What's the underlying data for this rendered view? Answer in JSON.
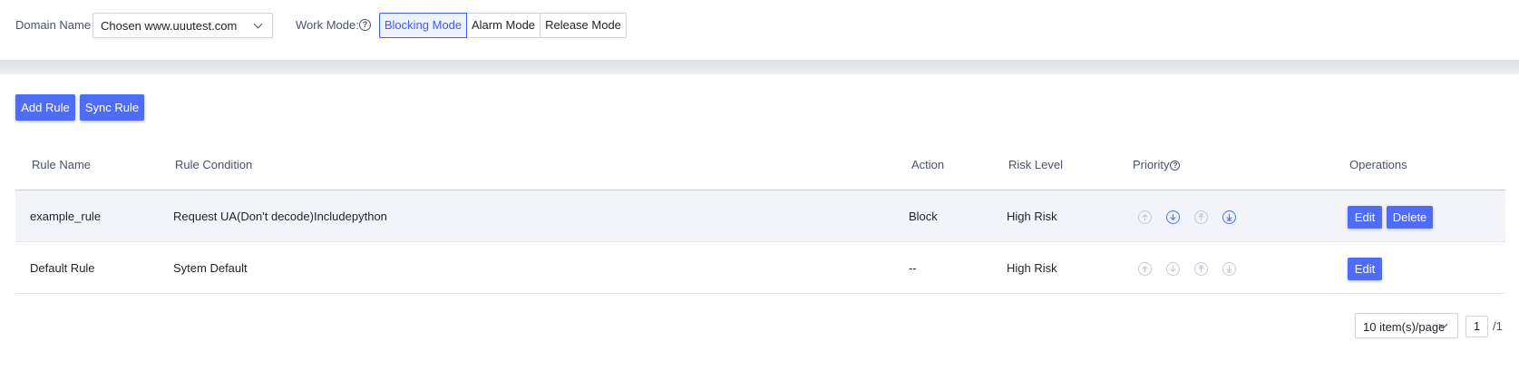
{
  "filter": {
    "domain_label": "Domain Name",
    "domain_value": "Chosen www.uuutest.com",
    "work_mode_label": "Work Mode:",
    "modes": [
      {
        "label": "Blocking Mode",
        "active": true
      },
      {
        "label": "Alarm Mode",
        "active": false
      },
      {
        "label": "Release Mode",
        "active": false
      }
    ]
  },
  "actions": {
    "add_rule": "Add Rule",
    "sync_rule": "Sync Rule"
  },
  "table": {
    "columns": [
      "Rule Name",
      "Rule Condition",
      "Action",
      "Risk Level",
      "Priority",
      "Operations"
    ],
    "rows": [
      {
        "name": "example_rule",
        "condition": "Request UA(Don't decode)Includepython",
        "action": "Block",
        "risk": "High Risk",
        "edit": "Edit",
        "delete": "Delete"
      },
      {
        "name": "Default Rule",
        "condition": "Sytem Default",
        "action": "--",
        "risk": "High Risk",
        "edit": "Edit"
      }
    ],
    "priority_icons": [
      "move-top-icon",
      "move-down-icon",
      "move-up-icon",
      "move-bottom-icon"
    ]
  },
  "pagination": {
    "page_size": "10 item(s)/page",
    "current_page": "1",
    "total": "/1"
  },
  "colors": {
    "primary": "#4f6cf7",
    "active_mode": "#3d5afe"
  }
}
